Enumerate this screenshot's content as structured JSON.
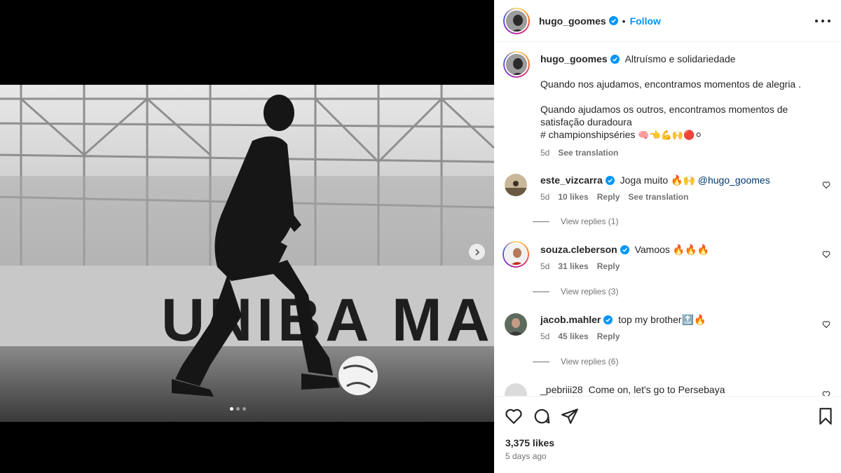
{
  "post": {
    "username": "hugo_goomes",
    "follow_label": "Follow",
    "separator": "•",
    "caption_title": "Altruísmo e solidariedade",
    "caption_line1": "Quando nos ajudamos, encontramos momentos de alegria .",
    "caption_line2": "Quando ajudamos os outros, encontramos momentos de satisfação duradoura",
    "caption_tag": "# championshipséries",
    "caption_emojis": "🧠👈💪🙌🔴⚪",
    "caption_age": "5d",
    "see_translation": "See translation",
    "banner_text": "UNIBA MADUR",
    "carousel": {
      "count": 3,
      "active": 0
    }
  },
  "comments": [
    {
      "username": "este_vizcarra",
      "text": "Joga muito 🔥🙌 ",
      "mention": "@hugo_goomes",
      "age": "5d",
      "likes": "10 likes",
      "reply": "Reply",
      "translate": "See translation",
      "view_replies": "View replies (1)"
    },
    {
      "username": "souza.cleberson",
      "text": "Vamoos 🔥🔥🔥",
      "age": "5d",
      "likes": "31 likes",
      "reply": "Reply",
      "view_replies": "View replies (3)"
    },
    {
      "username": "jacob.mahler",
      "text": "top my brother🔝🔥",
      "age": "5d",
      "likes": "45 likes",
      "reply": "Reply",
      "view_replies": "View replies (6)"
    },
    {
      "username": "_pebriii28",
      "text": "Come on, let's go to Persebaya"
    }
  ],
  "footer": {
    "likes": "3,375 likes",
    "date": "5 days ago"
  },
  "icons": {
    "heart": "heart-icon",
    "comment": "comment-icon",
    "share": "share-icon",
    "save": "bookmark-icon",
    "more": "more-options-icon",
    "verified": "verified-badge-icon",
    "next": "chevron-right-icon"
  },
  "colors": {
    "accent": "#0095f6",
    "verified": "#0095f6",
    "muted": "#737373"
  }
}
